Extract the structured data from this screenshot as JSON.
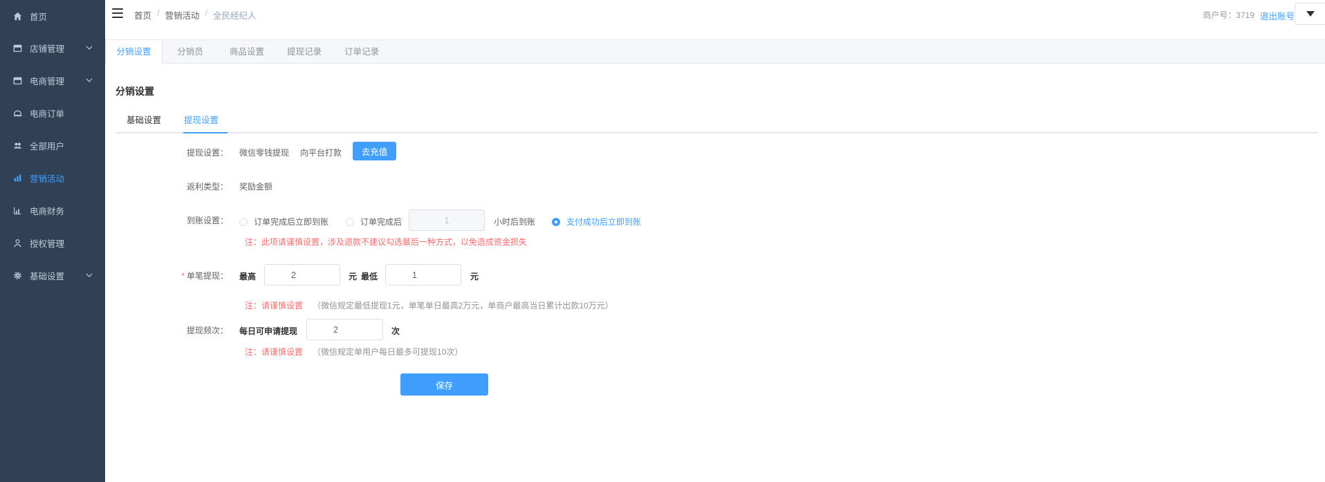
{
  "sidebar": {
    "items": [
      {
        "label": "首页"
      },
      {
        "label": "店铺管理"
      },
      {
        "label": "电商管理"
      },
      {
        "label": "电商订单"
      },
      {
        "label": "全部用户"
      },
      {
        "label": "营销活动"
      },
      {
        "label": "电商财务"
      },
      {
        "label": "授权管理"
      },
      {
        "label": "基础设置"
      }
    ]
  },
  "header": {
    "breadcrumb": [
      "首页",
      "营销活动",
      "全民经纪人"
    ],
    "breadcrumb_sep": "/",
    "merchant": "商户号：3719",
    "logout": "退出账号"
  },
  "tabs": [
    "分销设置",
    "分销员",
    "商品设置",
    "提现记录",
    "订单记录"
  ],
  "section_title": "分销设置",
  "subtabs": [
    "基础设置",
    "提现设置"
  ],
  "form": {
    "withdraw": {
      "label": "提现设置：",
      "option1": "微信零钱提现",
      "option2": "向平台打款",
      "button": "去充值"
    },
    "rebate": {
      "label": "返利类型：",
      "value": "奖励金额"
    },
    "arrival": {
      "label": "到账设置：",
      "radio1": "订单完成后立即到账",
      "radio2_prefix": "订单完成后",
      "hours_value": "1",
      "radio2_suffix": "小时后到账",
      "radio3": "支付成功后立即到账",
      "note": "注：此项请谨慎设置，涉及退款不建议勾选最后一种方式，以免造成资金损失"
    },
    "single": {
      "required_mark": "*",
      "label": "单笔提现：",
      "max_label": "最高",
      "max_value": "2",
      "unit1": "元",
      "min_label": "最低",
      "min_value": "1",
      "unit2": "元",
      "note_red": "注：请谨慎设置",
      "note_gray": "（微信规定最低提现1元，单笔单日最高2万元，单商户最高当日累计出款10万元）"
    },
    "frequency": {
      "label": "提现频次：",
      "prefix": "每日可申请提现",
      "value": "2",
      "suffix": "次",
      "note_red": "注：请谨慎设置",
      "note_gray": "（微信规定单用户每日最多可提现10次）"
    },
    "save": "保存"
  },
  "colors": {
    "sidebar_bg": "#304156",
    "accent": "#409eff",
    "danger": "#f56c6c"
  }
}
